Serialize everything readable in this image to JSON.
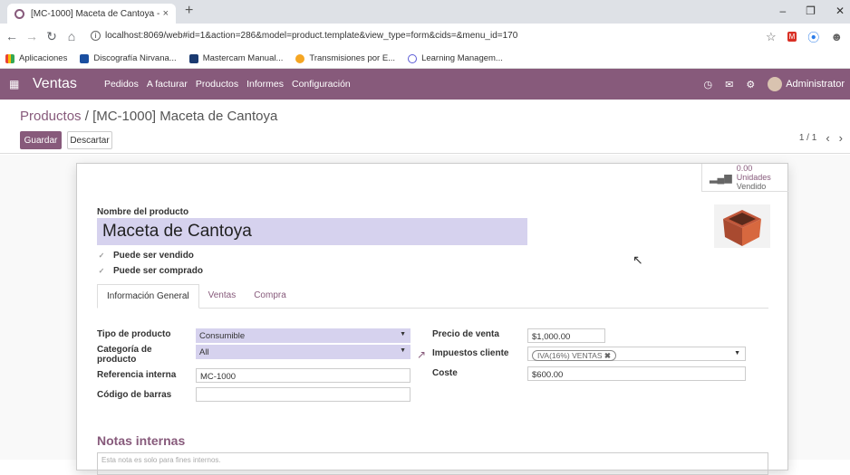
{
  "browser": {
    "tab_title": "[MC-1000] Maceta de Cantoya -",
    "tab_close": "×",
    "new_tab": "+",
    "url": "localhost:8069/web#id=1&action=286&model=product.template&view_type=form&cids=&menu_id=170",
    "bookmarks": [
      "Aplicaciones",
      "Discografía Nirvana...",
      "Mastercam Manual...",
      "Transmisiones por E...",
      "Learning Managem..."
    ]
  },
  "navbar": {
    "app_name": "Ventas",
    "menu": [
      "Pedidos",
      "A facturar",
      "Productos",
      "Informes",
      "Configuración"
    ],
    "user": "Administrator"
  },
  "control": {
    "breadcrumb_parent": "Productos",
    "breadcrumb_sep": " / ",
    "breadcrumb_current": "[MC-1000] Maceta de Cantoya",
    "save_label": "Guardar",
    "discard_label": "Descartar",
    "pager": "1 / 1"
  },
  "sheet": {
    "stat_value": "0.00 Unidades",
    "stat_label": "Vendido",
    "name_label": "Nombre del producto",
    "name_value": "Maceta de Cantoya",
    "can_be_sold": "Puede ser vendido",
    "can_be_purchased": "Puede ser comprado",
    "tabs": [
      "Información General",
      "Ventas",
      "Compra"
    ],
    "fields": {
      "type_label": "Tipo de producto",
      "type_value": "Consumible",
      "category_label": "Categoría de producto",
      "category_value": "All",
      "ref_label": "Referencia interna",
      "ref_value": "MC-1000",
      "barcode_label": "Código de barras",
      "barcode_value": "",
      "price_label": "Precio de venta",
      "price_value": "$1,000.00",
      "taxes_label": "Impuestos cliente",
      "taxes_value": "IVA(16%) VENTAS",
      "cost_label": "Coste",
      "cost_value": "$600.00"
    },
    "notes_title": "Notas internas",
    "notes_placeholder": "Esta nota es solo para fines internos."
  },
  "colors": {
    "brand": "#875a7b",
    "required": "#d6d2ee"
  }
}
